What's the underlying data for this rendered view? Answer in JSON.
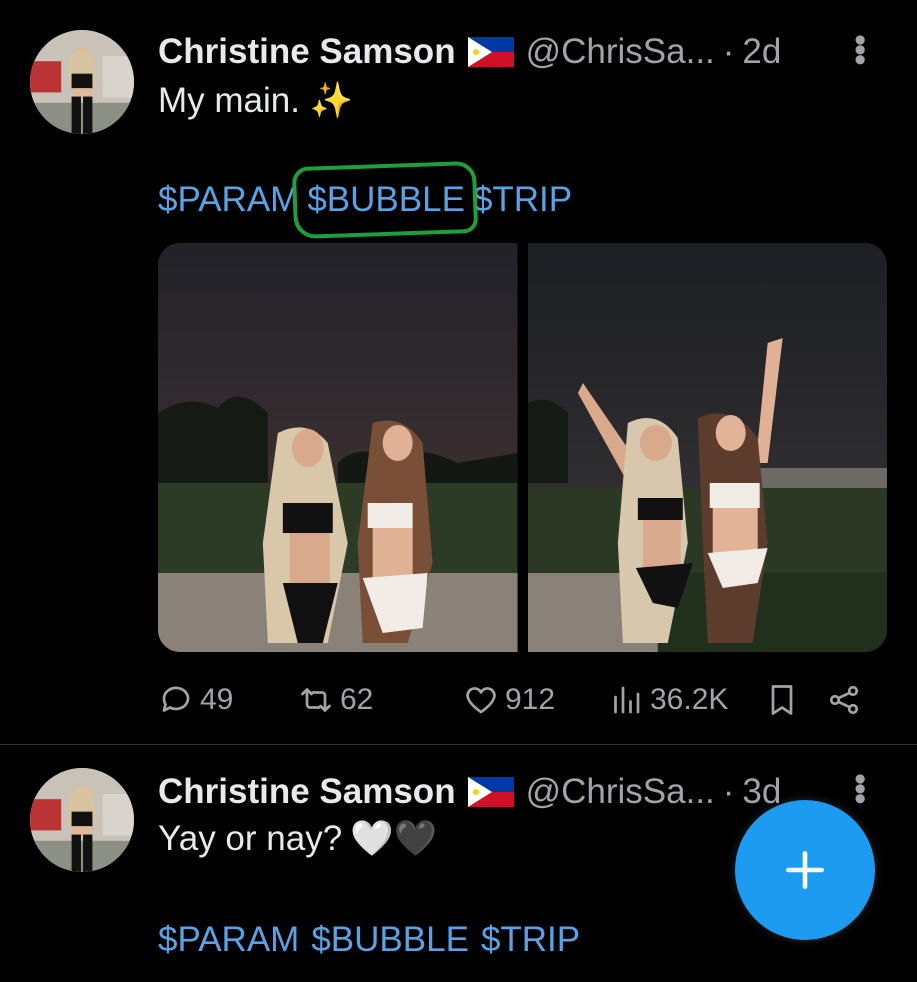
{
  "tweets": [
    {
      "author_name": "Christine Samson",
      "handle": "@ChrisSa...",
      "separator": "·",
      "time": "2d",
      "text": "My main. ✨",
      "cashtags": [
        "$PARAM",
        "$BUBBLE",
        "$TRIP"
      ],
      "highlighted_cashtag_index": 1,
      "annotation_color": "#1f9e3a",
      "stats": {
        "replies": "49",
        "retweets": "62",
        "likes": "912",
        "views": "36.2K"
      }
    },
    {
      "author_name": "Christine Samson",
      "handle": "@ChrisSa...",
      "separator": "·",
      "time": "3d",
      "text": "Yay or nay?",
      "emojis": "🤍🖤",
      "cashtags": [
        "$PARAM",
        "$BUBBLE",
        "$TRIP"
      ]
    }
  ],
  "icons": {
    "flag": "philippines-flag-icon",
    "more": "more-vertical-icon",
    "reply": "reply-icon",
    "retweet": "retweet-icon",
    "like": "heart-icon",
    "views": "views-icon",
    "bookmark": "bookmark-icon",
    "share": "share-icon",
    "compose": "plus-icon"
  },
  "colors": {
    "background": "#000000",
    "text": "#e7e9ea",
    "secondary": "#a0a4a8",
    "link": "#5aa2e6",
    "accent": "#1d9bf0"
  }
}
